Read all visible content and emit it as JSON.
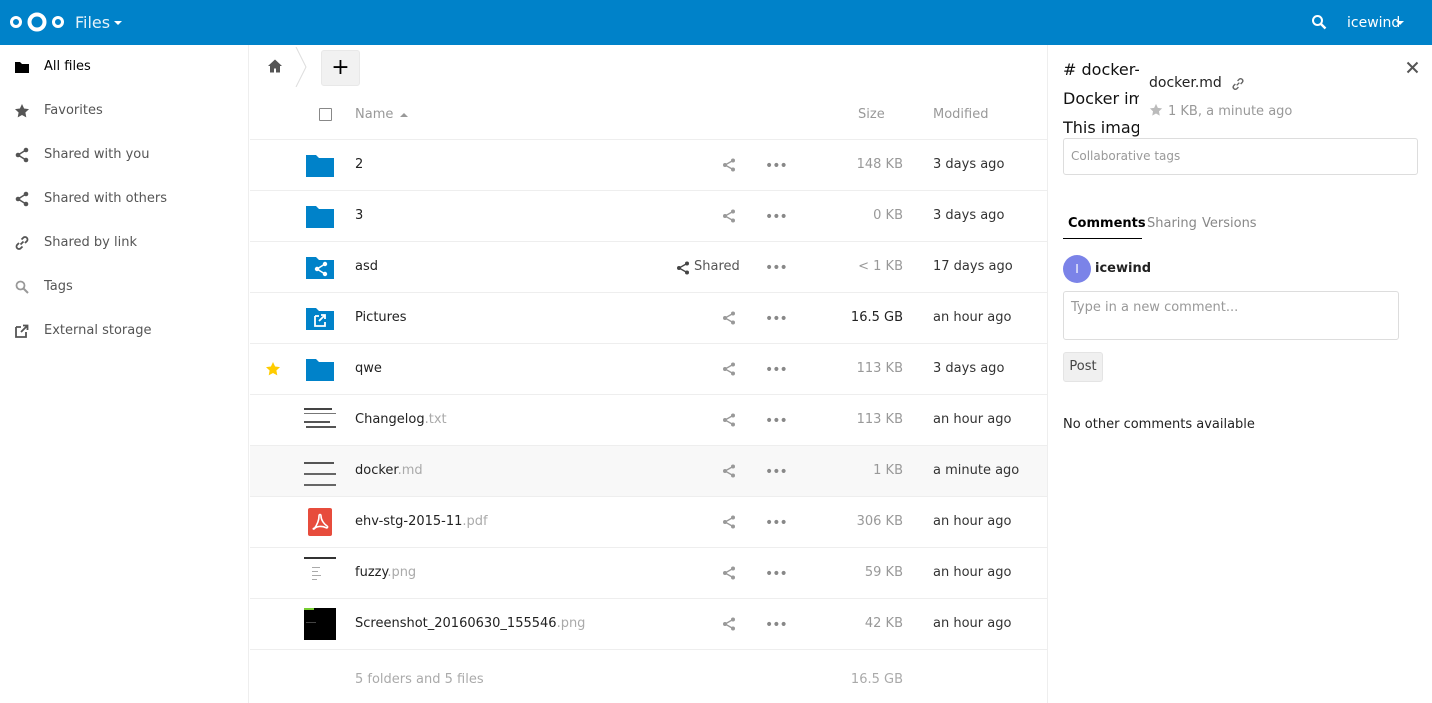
{
  "header": {
    "app_name": "Files",
    "user": "icewind",
    "brand_color": "#0082c9"
  },
  "nav": {
    "items": [
      {
        "label": "All files",
        "icon": "folder-icon"
      },
      {
        "label": "Favorites",
        "icon": "star-icon"
      },
      {
        "label": "Shared with you",
        "icon": "share-icon"
      },
      {
        "label": "Shared with others",
        "icon": "share-icon"
      },
      {
        "label": "Shared by link",
        "icon": "link-icon"
      },
      {
        "label": "Tags",
        "icon": "tag-search-icon"
      },
      {
        "label": "External storage",
        "icon": "external-icon"
      }
    ]
  },
  "list": {
    "columns": {
      "name": "Name",
      "size": "Size",
      "modified": "Modified"
    },
    "rows": [
      {
        "name": "2",
        "ext": "",
        "size": "148 KB",
        "modified": "3 days ago",
        "type": "folder"
      },
      {
        "name": "3",
        "ext": "",
        "size": "0 KB",
        "modified": "3 days ago",
        "type": "folder"
      },
      {
        "name": "asd",
        "ext": "",
        "size": "< 1 KB",
        "modified": "17 days ago",
        "type": "folder-shared",
        "shared_label": "Shared"
      },
      {
        "name": "Pictures",
        "ext": "",
        "size": "16.5 GB",
        "modified": "an hour ago",
        "type": "folder-external"
      },
      {
        "name": "qwe",
        "ext": "",
        "size": "113 KB",
        "modified": "3 days ago",
        "type": "folder",
        "favorite": true
      },
      {
        "name": "Changelog",
        "ext": ".txt",
        "size": "113 KB",
        "modified": "an hour ago",
        "type": "text"
      },
      {
        "name": "docker",
        "ext": ".md",
        "size": "1 KB",
        "modified": "a minute ago",
        "type": "markdown"
      },
      {
        "name": "ehv-stg-2015-11",
        "ext": ".pdf",
        "size": "306 KB",
        "modified": "an hour ago",
        "type": "pdf"
      },
      {
        "name": "fuzzy",
        "ext": ".png",
        "size": "59 KB",
        "modified": "an hour ago",
        "type": "image"
      },
      {
        "name": "Screenshot_20160630_155546",
        "ext": ".png",
        "size": "42 KB",
        "modified": "an hour ago",
        "type": "image-dark"
      }
    ],
    "summary": "5 folders and 5 files",
    "summary_size": "16.5 GB"
  },
  "details": {
    "preview_lines": [
      "# docker-c",
      "Docker ima",
      "This image"
    ],
    "file_name": "docker.md",
    "meta": "1 KB, a minute ago",
    "tags_placeholder": "Collaborative tags",
    "tabs": [
      "Comments",
      "Sharing",
      "Versions"
    ],
    "avatar_letter": "I",
    "comment_user": "icewind",
    "comment_placeholder": "Type in a new comment...",
    "post_label": "Post",
    "no_comments": "No other comments available"
  }
}
